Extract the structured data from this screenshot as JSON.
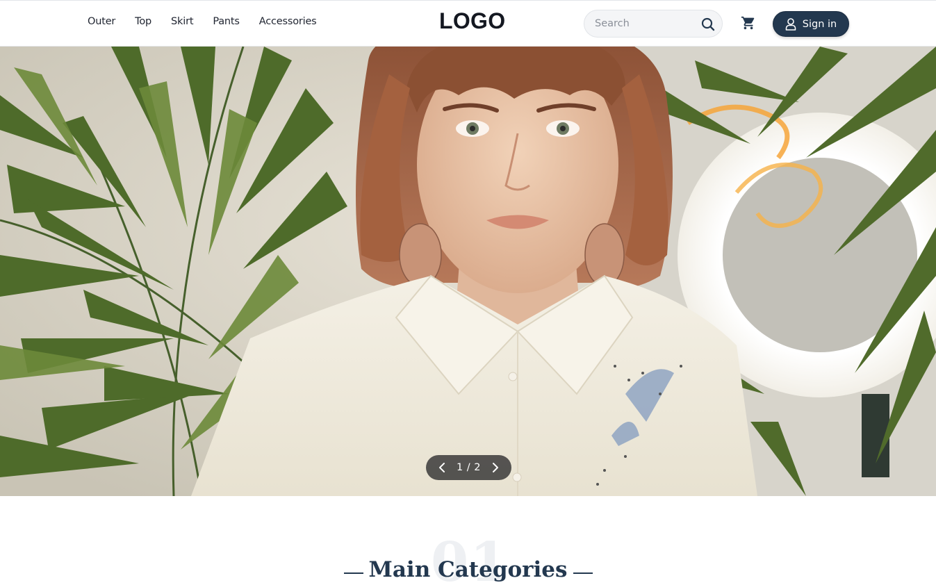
{
  "header": {
    "nav": [
      "Outer",
      "Top",
      "Skirt",
      "Pants",
      "Accessories"
    ],
    "logo": "LOGO",
    "search_placeholder": "Search",
    "signin_label": "Sign in"
  },
  "hero": {
    "slide_indicator": "1 / 2",
    "slide_current": 1,
    "slide_total": 2
  },
  "section": {
    "number": "01",
    "title": "Main Categories"
  },
  "colors": {
    "primary": "#23384f",
    "text": "#1f2430",
    "search_bg": "#f4f5f7"
  },
  "icons": [
    "search-icon",
    "cart-icon",
    "user-icon",
    "chevron-left-icon",
    "chevron-right-icon"
  ]
}
